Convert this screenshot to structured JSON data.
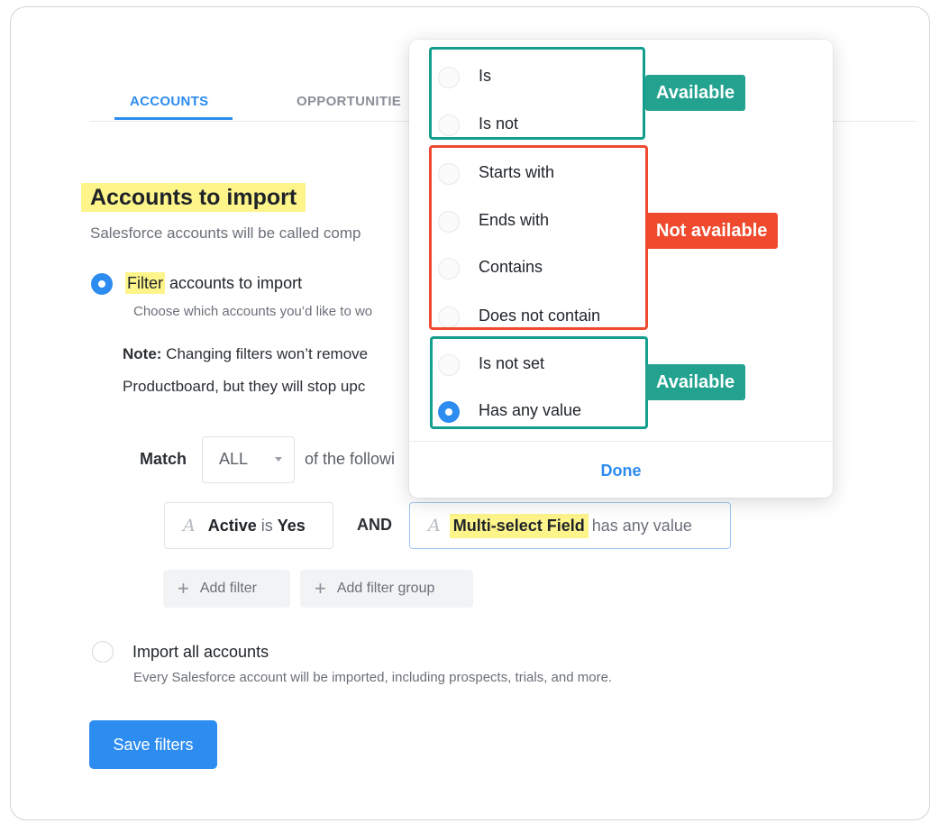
{
  "tabs": [
    {
      "label": "ACCOUNTS",
      "active": true
    },
    {
      "label": "OPPORTUNITIE",
      "active": false
    }
  ],
  "section": {
    "title": "Accounts to import",
    "subtitle": "Salesforce accounts will be called comp"
  },
  "filter_option": {
    "title_highlight": "Filter",
    "title_rest": " accounts to import",
    "description": "Choose which accounts you’d like to wo",
    "selected": true
  },
  "note": {
    "label": "Note:",
    "line1": " Changing filters won’t remove",
    "line2": "Productboard, but they will stop upc"
  },
  "match": {
    "label": "Match",
    "value": "ALL",
    "after": "of the followi"
  },
  "filters": [
    {
      "field": "Active",
      "operator": "is",
      "value": "Yes",
      "icon": "text-field-icon"
    },
    {
      "field": "Multi-select Field",
      "operator": "has any value",
      "icon": "text-field-icon"
    }
  ],
  "conjunction": "AND",
  "buttons": {
    "add_filter": "Add filter",
    "add_filter_group": "Add filter group",
    "save": "Save filters"
  },
  "import_all_option": {
    "title": "Import all accounts",
    "description": "Every Salesforce account will be imported, including prospects, trials, and more.",
    "selected": false
  },
  "dropdown": {
    "options": [
      {
        "label": "Is",
        "selected": false
      },
      {
        "label": "Is not",
        "selected": false
      },
      {
        "label": "Starts with",
        "selected": false
      },
      {
        "label": "Ends with",
        "selected": false
      },
      {
        "label": "Contains",
        "selected": false
      },
      {
        "label": "Does not contain",
        "selected": false
      },
      {
        "label": "Is not set",
        "selected": false
      },
      {
        "label": "Has any value",
        "selected": true
      }
    ],
    "done_label": "Done"
  },
  "annotations": {
    "available_top": "Available",
    "not_available": "Not available",
    "available_bottom": "Available",
    "colors": {
      "available": "#23a28f",
      "not_available": "#ef4a2e",
      "highlight": "#fdf48a",
      "accent": "#2d8cf0"
    }
  }
}
